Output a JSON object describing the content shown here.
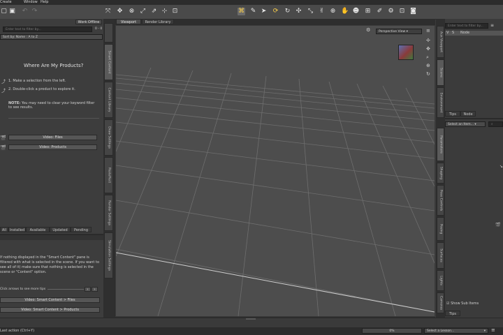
{
  "menu": [
    "Create",
    "Window",
    "Help"
  ],
  "toolbar": {
    "left_icons": [
      "open-file-icon",
      "save-icon",
      "undo-icon",
      "redo-icon"
    ],
    "tools": [
      "rotate-tool-icon",
      "translate-tool-icon",
      "scale-tool-icon",
      "node-select-icon",
      "joint-editor-icon",
      "region-nav-icon",
      "surface-selection-icon",
      "geometry-editor-icon",
      "universal-tool-icon",
      "pointer-icon",
      "rotate-view-icon",
      "move-view-icon",
      "scale-view-icon",
      "pose-tool-icon",
      "figure-icon",
      "transform-icon",
      "camera-icon",
      "light-icon",
      "render-settings-icon",
      "render-icon"
    ]
  },
  "left_panel": {
    "work_offline": "Work Offline",
    "search_placeholder": "Enter text to filter by...",
    "count": "0 - 0",
    "sort": "Sort by: Name : A to Z",
    "heading": "Where Are My Products?",
    "step1": "1. Make a selection from the left.",
    "step2": "2. Double-click a product to explore it.",
    "note_bold": "NOTE:",
    "note": " You may need to clear your keyword filter to see results.",
    "btn_files": "Video: Files",
    "btn_products": "Video: Products",
    "bottom_tabs": [
      "All",
      "Installed",
      "Available",
      "Updated",
      "Pending"
    ],
    "tip_text": "If nothing displayed in the \"Smart Content\" pane is filtered with what is selected in the scene. If you want to see all of it) make sure that nothing is selected in the scene or \"Content\" option.",
    "tip_nav": "Click arrows to see more tips",
    "video_files": "Video: Smart Content > Files",
    "video_products": "Video: Smart Content > Products"
  },
  "left_vtabs": [
    "Smart Content",
    "Content Library",
    "Draw Settings",
    "Posteffect",
    "Render Settings",
    "Simulation Settings"
  ],
  "viewport": {
    "tabs": [
      "Viewport",
      "Render Library"
    ],
    "camera": "Perspective View"
  },
  "right_vtabs": [
    "Aux Viewport",
    "Scene",
    "Environment"
  ],
  "right_vtabs_lower": [
    "Parameters",
    "Shaping",
    "Pose Controls",
    "Posing",
    "Surfaces",
    "Lights",
    "Cameras"
  ],
  "scene": {
    "search_placeholder": "Enter text to filter by...",
    "node_label": "Node",
    "tabs": [
      "Tips",
      "Node"
    ]
  },
  "params": {
    "select": "Select an Item...",
    "show_sub_items": "Show Sub Items",
    "bottom_tab": "Tips"
  },
  "bottom": {
    "progress": "0%",
    "lesson": "Select a Lesson..."
  },
  "status": {
    "left": "Last action (Ctrl+Y)"
  }
}
